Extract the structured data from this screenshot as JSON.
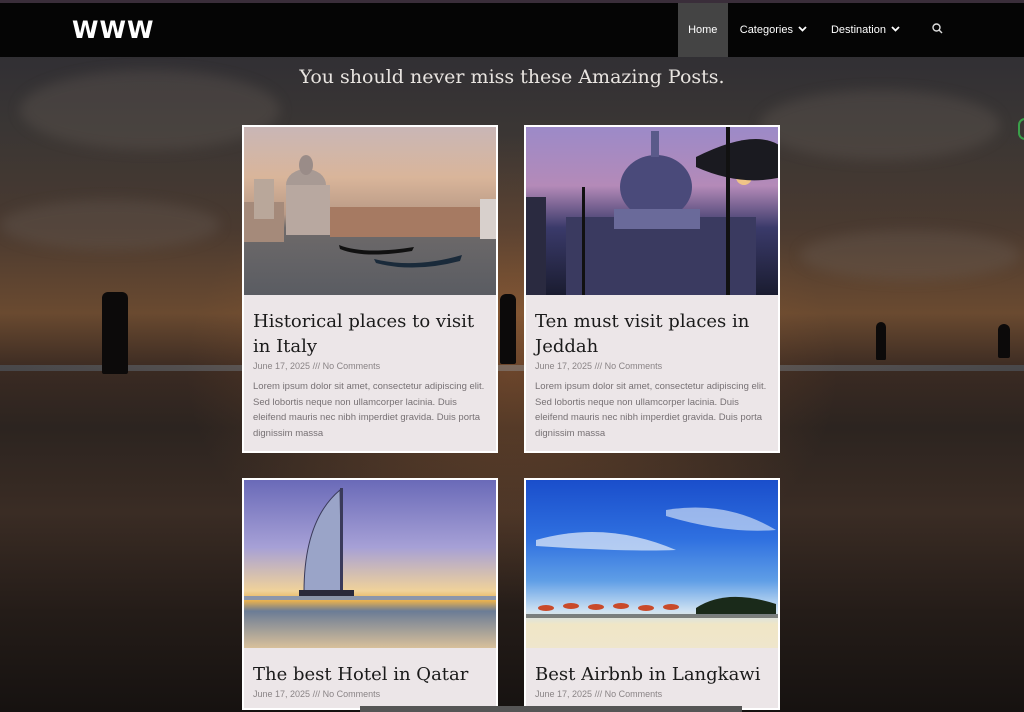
{
  "site": {
    "logo": "WWW"
  },
  "nav": {
    "items": [
      {
        "label": "Home",
        "active": true
      },
      {
        "label": "Categories",
        "dropdown": true
      },
      {
        "label": "Destination",
        "dropdown": true
      }
    ],
    "search_icon": "search-icon"
  },
  "section": {
    "title": "You should never miss these Amazing Posts."
  },
  "posts": [
    {
      "title": "Historical places to visit in Italy",
      "date": "June 17, 2025",
      "separator": "///",
      "comments": "No Comments",
      "excerpt": "Lorem ipsum dolor sit amet, consectetur adipiscing elit. Sed lobortis neque non ullamcorper lacinia. Duis eleifend mauris nec nibh imperdiet gravida. Duis porta dignissim massa"
    },
    {
      "title": "Ten must visit places in Jeddah",
      "date": "June 17, 2025",
      "separator": "///",
      "comments": "No Comments",
      "excerpt": "Lorem ipsum dolor sit amet, consectetur adipiscing elit. Sed lobortis neque non ullamcorper lacinia. Duis eleifend mauris nec nibh imperdiet gravida. Duis porta dignissim massa"
    },
    {
      "title": "The best Hotel in Qatar",
      "date": "June 17, 2025",
      "separator": "///",
      "comments": "No Comments",
      "excerpt": ""
    },
    {
      "title": "Best Airbnb in Langkawi",
      "date": "June 17, 2025",
      "separator": "///",
      "comments": "No Comments",
      "excerpt": ""
    }
  ],
  "colors": {
    "nav_bg": "#050505",
    "active_bg": "#444444",
    "card_bg": "#ece6e8"
  }
}
